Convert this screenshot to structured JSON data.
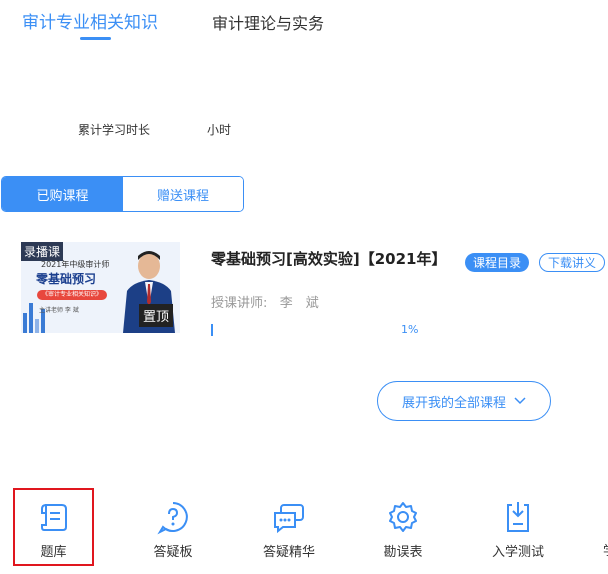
{
  "tabs": [
    {
      "label": "审计专业相关知识"
    },
    {
      "label": "审计理论与实务"
    }
  ],
  "study": {
    "label": "累计学习时长",
    "unit": "小时"
  },
  "segments": {
    "purchased": "已购课程",
    "gifted": "赠送课程"
  },
  "course": {
    "thumb_tag": "录播课",
    "thumb_line1": "2021年中级审计师",
    "thumb_title": "零基础预习",
    "thumb_pill": "《审计专业相关知识》",
    "thumb_line3": "主讲老师 李 斌",
    "pin_label": "置顶",
    "title": "零基础预习[高效实验]【2021年】",
    "catalog_button": "课程目录",
    "download_button": "下载讲义",
    "teacher_label": "授课讲师:",
    "teacher_name": "李　斌",
    "progress_text": "1%",
    "progress": 0.01
  },
  "expand_button": "展开我的全部课程",
  "bottom_nav": [
    {
      "label": "题库",
      "icon": "question-bank-icon"
    },
    {
      "label": "答疑板",
      "icon": "qa-board-icon"
    },
    {
      "label": "答疑精华",
      "icon": "qa-highlights-icon"
    },
    {
      "label": "勘误表",
      "icon": "errata-gear-icon"
    },
    {
      "label": "入学测试",
      "icon": "entrance-test-icon"
    }
  ],
  "bottom_nav_partial": "学",
  "colors": {
    "accent": "#3b8ff5",
    "highlight_border": "#e0161e"
  }
}
